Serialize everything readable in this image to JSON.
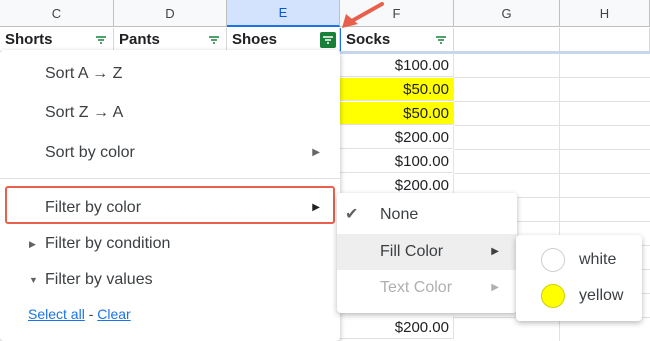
{
  "columns": [
    {
      "letter": "C",
      "selected": false
    },
    {
      "letter": "D",
      "selected": false
    },
    {
      "letter": "E",
      "selected": true
    },
    {
      "letter": "F",
      "selected": false
    },
    {
      "letter": "G",
      "selected": false
    },
    {
      "letter": "H",
      "selected": false
    }
  ],
  "header_row": [
    "Shorts",
    "Pants",
    "Shoes",
    "Socks"
  ],
  "socks_values": [
    "$100.00",
    "$50.00",
    "$50.00",
    "$200.00",
    "$100.00",
    "$200.00",
    "$200.00"
  ],
  "colors": {
    "highlight_yellow": "#ffff00",
    "annotation": "#e8604c",
    "filter_active": "#188038",
    "link": "#1a73e8"
  },
  "menu": {
    "sort_az": "Sort A → Z",
    "sort_za": "Sort Z → A",
    "sort_by_color": "Sort by color",
    "filter_by_color": "Filter by color",
    "filter_by_condition": "Filter by condition",
    "filter_by_values": "Filter by values",
    "select_all": "Select all",
    "separator": " - ",
    "clear": "Clear"
  },
  "color_submenu": {
    "none": "None",
    "fill_color": "Fill Color",
    "text_color": "Text Color"
  },
  "fill_submenu": [
    {
      "label": "white",
      "swatch": "#ffffff"
    },
    {
      "label": "yellow",
      "swatch": "#ffff00"
    }
  ]
}
